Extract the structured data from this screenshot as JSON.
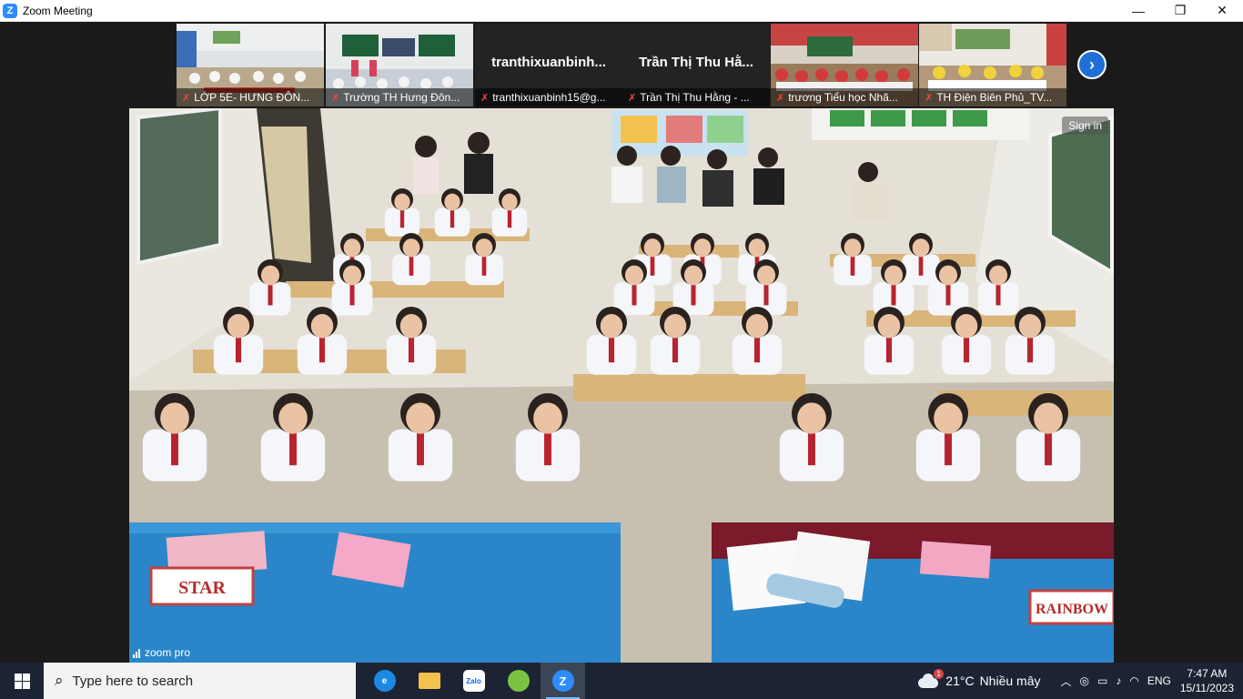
{
  "window": {
    "title": "Zoom Meeting",
    "logo": "Z",
    "minimize": "—",
    "restore": "❐",
    "close": "✕"
  },
  "participants": [
    {
      "label": "LỚP 5E- HƯNG ĐÔN...",
      "video": true,
      "scene": "classroom-blue"
    },
    {
      "label": "Trường TH Hưng Đôn...",
      "video": true,
      "scene": "stage"
    },
    {
      "label": "tranthixuanbinh15@g...",
      "video": false,
      "name": "tranthixuanbinh..."
    },
    {
      "label": "Trần Thị Thu Hằng - ...",
      "video": false,
      "name": "Trần Thị Thu Hằ..."
    },
    {
      "label": "trương Tiểu học Nhã...",
      "video": true,
      "scene": "classroom-red"
    },
    {
      "label": "TH Điện Biên Phủ_TV...",
      "video": true,
      "scene": "classroom-yellow"
    }
  ],
  "next_page_icon": "›",
  "main_video": {
    "sign_in": "Sign in",
    "desk_signs": [
      "STAR",
      "RAINBOW"
    ]
  },
  "connection_label": "zoom pro",
  "taskbar": {
    "search_placeholder": "Type here to search",
    "apps": [
      {
        "name": "edge",
        "glyph": "e",
        "color": "#1e88e5"
      },
      {
        "name": "file-explorer",
        "glyph": "",
        "color": "#f2c14e"
      },
      {
        "name": "zalo",
        "glyph": "Zalo",
        "color": "#ffffff"
      },
      {
        "name": "coc-coc",
        "glyph": "",
        "color": "#7cc242"
      },
      {
        "name": "zoom",
        "glyph": "Z",
        "color": "#2d8cff"
      }
    ],
    "weather": {
      "temp": "21°C",
      "desc": "Nhiều mây",
      "badge": "1"
    },
    "language": "ENG",
    "time": "7:47 AM",
    "date": "15/11/2023"
  }
}
